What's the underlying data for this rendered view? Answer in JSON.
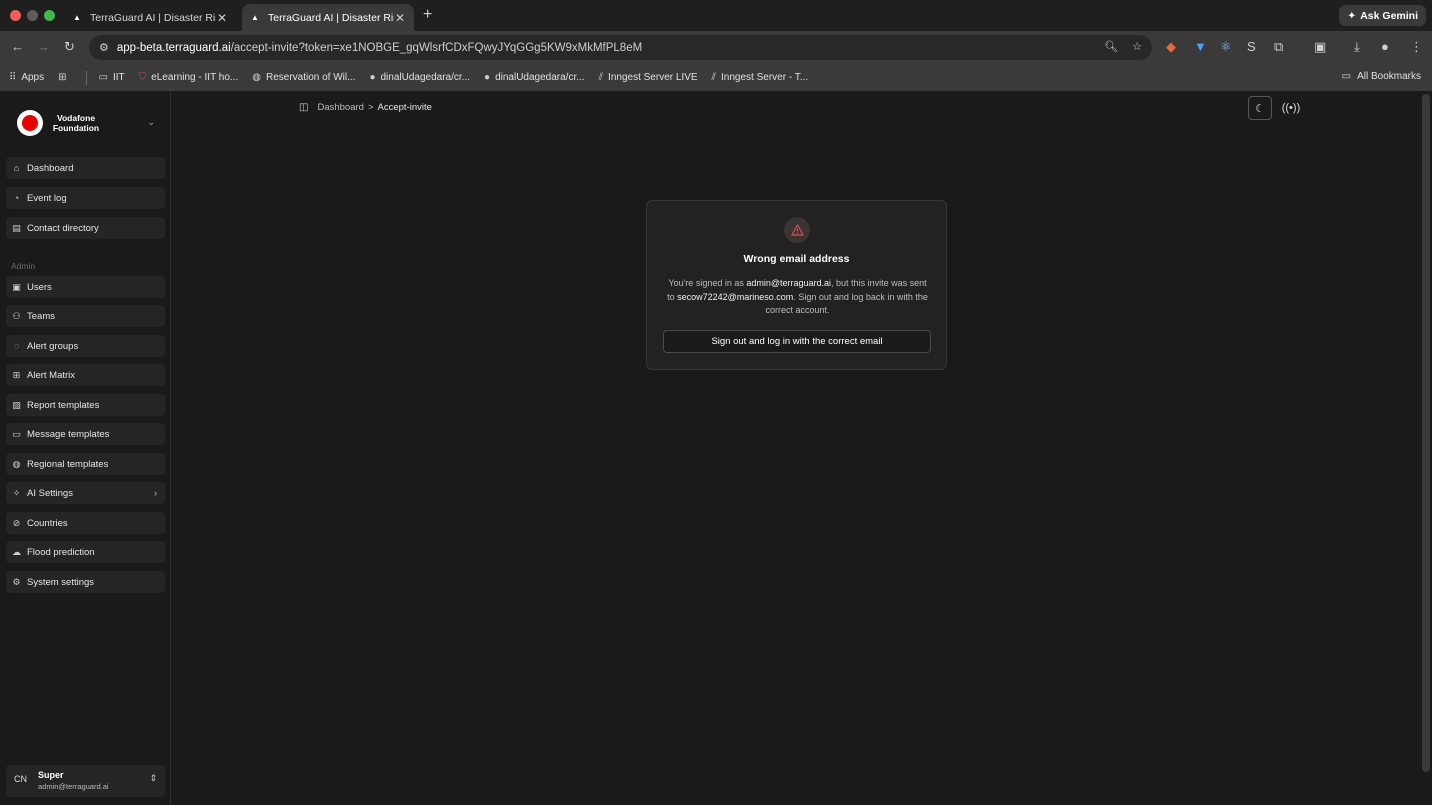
{
  "browser": {
    "tabs": [
      {
        "title": "TerraGuard AI | Disaster Risk I",
        "active": false
      },
      {
        "title": "TerraGuard AI | Disaster Risk I",
        "active": true
      }
    ],
    "ask_gemini": "Ask Gemini",
    "url_host": "app-beta.terraguard.ai",
    "url_path": "/accept-invite?token=xe1NOBGE_gqWlsrfCDxFQwyJYqGGg5KW9xMkMfPL8eM",
    "bookmarks": [
      {
        "label": "Apps",
        "icon": "apps-grid-icon"
      },
      {
        "label": "IIT",
        "icon": "folder-icon"
      },
      {
        "label": "eLearning - IIT ho...",
        "icon": "shield-icon"
      },
      {
        "label": "Reservation of Wil...",
        "icon": "globe-icon"
      },
      {
        "label": "dinalUdagedara/cr...",
        "icon": "github-icon"
      },
      {
        "label": "dinalUdagedara/cr...",
        "icon": "github-icon"
      },
      {
        "label": "Inngest Server LIVE",
        "icon": "inngest-icon"
      },
      {
        "label": "Inngest Server - T...",
        "icon": "inngest-icon"
      }
    ],
    "all_bookmarks": "All Bookmarks"
  },
  "sidebar": {
    "org_name": "Vodafone Foundation",
    "nav_items": [
      {
        "label": "Dashboard",
        "icon": "home-icon"
      },
      {
        "label": "Event log",
        "icon": "event-log-icon"
      },
      {
        "label": "Contact directory",
        "icon": "contact-directory-icon"
      }
    ],
    "admin_label": "Admin",
    "admin_items": [
      {
        "label": "Users",
        "icon": "users-icon"
      },
      {
        "label": "Teams",
        "icon": "teams-icon"
      },
      {
        "label": "Alert groups",
        "icon": "alert-groups-icon"
      },
      {
        "label": "Alert Matrix",
        "icon": "alert-matrix-icon"
      },
      {
        "label": "Report templates",
        "icon": "report-templates-icon"
      },
      {
        "label": "Message templates",
        "icon": "message-templates-icon"
      },
      {
        "label": "Regional templates",
        "icon": "globe-icon"
      },
      {
        "label": "AI Settings",
        "icon": "sparkles-icon",
        "has_submenu": true
      },
      {
        "label": "Countries",
        "icon": "countries-icon"
      },
      {
        "label": "Flood prediction",
        "icon": "cloud-icon"
      },
      {
        "label": "System settings",
        "icon": "gear-icon"
      }
    ],
    "user": {
      "initials": "CN",
      "name": "Super",
      "email": "admin@terraguard.ai"
    }
  },
  "main": {
    "breadcrumb": {
      "parent": "Dashboard",
      "separator": ">",
      "current": "Accept-invite"
    },
    "card": {
      "title": "Wrong email address",
      "msg_part1": "You're signed in as ",
      "signed_in_email": "admin@terraguard.ai",
      "msg_part2": ", but this invite was sent to ",
      "invite_email": "secow72242@marineso.com",
      "msg_part3": ". Sign out and log back in with the correct account.",
      "button_label": "Sign out and log in with the correct email"
    }
  },
  "colors": {
    "background": "#1b1a1a",
    "card": "#232222",
    "warning": "#e5484d",
    "brand_red": "#e60000"
  }
}
